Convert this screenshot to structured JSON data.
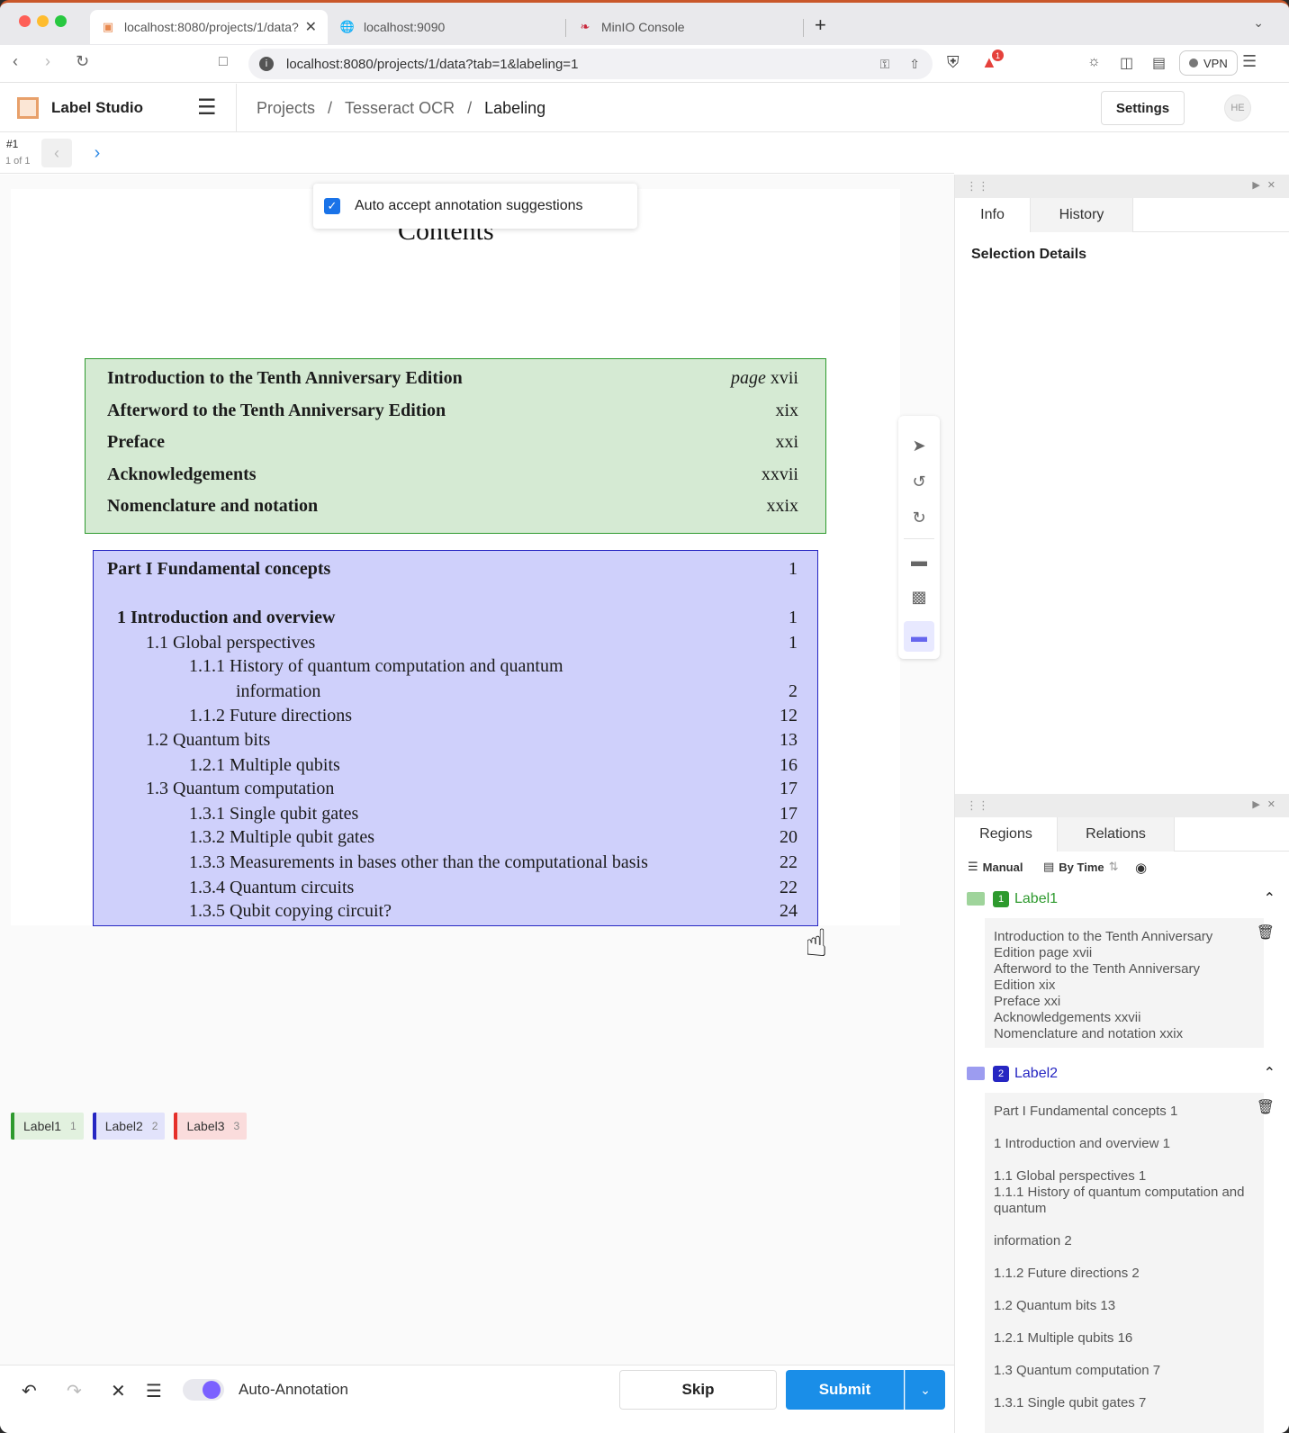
{
  "browser": {
    "tabs": [
      {
        "title": "localhost:8080/projects/1/data?",
        "active": true
      },
      {
        "title": "localhost:9090",
        "active": false
      },
      {
        "title": "MinIO Console",
        "active": false
      }
    ],
    "new_tab": "+",
    "url": "localhost:8080/projects/1/data?tab=1&labeling=1",
    "vpn_label": "VPN",
    "notification_count": "1"
  },
  "app": {
    "name": "Label Studio",
    "breadcrumb": [
      "Projects",
      "Tesseract OCR",
      "Labeling"
    ],
    "settings_label": "Settings",
    "avatar": "HE"
  },
  "task": {
    "id": "#1",
    "count": "1 of 1"
  },
  "canvas": {
    "heading": "Contents",
    "auto_accept_label": "Auto accept annotation suggestions",
    "green_rows": [
      {
        "title": "Introduction to the Tenth Anniversary Edition",
        "page_prefix": "page",
        "page": "xvii"
      },
      {
        "title": "Afterword to the Tenth Anniversary Edition",
        "page": "xix"
      },
      {
        "title": "Preface",
        "page": "xxi"
      },
      {
        "title": "Acknowledgements",
        "page": "xxvii"
      },
      {
        "title": "Nomenclature and notation",
        "page": "xxix"
      }
    ],
    "blue_rows": [
      {
        "title": "Part I  Fundamental concepts",
        "page": "1"
      },
      {
        "title": "1  Introduction and overview",
        "page": "1"
      },
      {
        "title": "1.1  Global perspectives",
        "page": "1"
      },
      {
        "title": "1.1.1  History of quantum computation and quantum",
        "page": ""
      },
      {
        "title": "information",
        "page": "2"
      },
      {
        "title": "1.1.2  Future directions",
        "page": "12"
      },
      {
        "title": "1.2  Quantum bits",
        "page": "13"
      },
      {
        "title": "1.2.1  Multiple qubits",
        "page": "16"
      },
      {
        "title": "1.3  Quantum computation",
        "page": "17"
      },
      {
        "title": "1.3.1  Single qubit gates",
        "page": "17"
      },
      {
        "title": "1.3.2  Multiple qubit gates",
        "page": "20"
      },
      {
        "title": "1.3.3  Measurements in bases other than the computational basis",
        "page": "22"
      },
      {
        "title": "1.3.4  Quantum circuits",
        "page": "22"
      },
      {
        "title": "1.3.5  Qubit copying circuit?",
        "page": "24"
      }
    ],
    "labels": [
      {
        "name": "Label1",
        "hotkey": "1"
      },
      {
        "name": "Label2",
        "hotkey": "2"
      },
      {
        "name": "Label3",
        "hotkey": "3"
      }
    ]
  },
  "bottom": {
    "auto_annotation_label": "Auto-Annotation",
    "skip_label": "Skip",
    "submit_label": "Submit"
  },
  "side": {
    "top_tabs": [
      "Info",
      "History"
    ],
    "selection_details": "Selection Details",
    "bottom_tabs": [
      "Regions",
      "Relations"
    ],
    "manual_label": "Manual",
    "by_time_label": "By Time",
    "groups": [
      {
        "num": "1",
        "name": "Label1",
        "lines": [
          "Introduction to the Tenth Anniversary",
          "Edition page xvii",
          "Afterword to the Tenth Anniversary",
          "Edition xix",
          "Preface xxi",
          "Acknowledgements xxvii",
          "Nomenclature and notation xxix"
        ]
      },
      {
        "num": "2",
        "name": "Label2",
        "lines": [
          "Part I Fundamental concepts 1",
          "1 Introduction and overview 1",
          "1.1 Global perspectives 1",
          "1.1.1 History of quantum computation and quantum",
          "information 2",
          "1.1.2 Future directions 2",
          "1.2 Quantum bits 13",
          "1.2.1 Multiple qubits 16",
          "1.3 Quantum computation 7",
          "1.3.1 Single qubit gates 7"
        ]
      }
    ]
  },
  "colors": {
    "label1": "#2e9a2e",
    "label2": "#2626c2",
    "label3": "#e5302a",
    "primary": "#1a8ee8"
  }
}
